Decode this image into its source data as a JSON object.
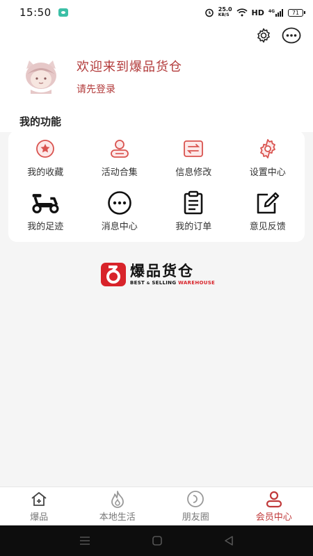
{
  "status_bar": {
    "time": "15:50",
    "net_speed_top": "25.0",
    "net_speed_unit": "KB/S",
    "network_label": "HD",
    "cell_label": "4G",
    "battery": "71"
  },
  "profile": {
    "welcome": "欢迎来到爆品货仓",
    "login_link": "请先登录"
  },
  "functions": {
    "title": "我的功能",
    "items": [
      {
        "label": "我的收藏",
        "icon": "star-badge-icon"
      },
      {
        "label": "活动合集",
        "icon": "user-card-icon"
      },
      {
        "label": "信息修改",
        "icon": "edit-info-icon"
      },
      {
        "label": "设置中心",
        "icon": "gear-icon"
      },
      {
        "label": "我的足迹",
        "icon": "scooter-icon"
      },
      {
        "label": "消息中心",
        "icon": "message-dots-icon"
      },
      {
        "label": "我的订单",
        "icon": "clipboard-icon"
      },
      {
        "label": "意见反馈",
        "icon": "pencil-square-icon"
      }
    ]
  },
  "brand": {
    "name_cn": "爆品货仓",
    "name_en_1": "BEST",
    "name_en_amp": "&",
    "name_en_2": "SELLING",
    "name_en_3": "WAREHOUSE"
  },
  "tabbar": {
    "tabs": [
      {
        "label": "爆品",
        "icon": "home-icon"
      },
      {
        "label": "本地生活",
        "icon": "flame-icon"
      },
      {
        "label": "朋友圈",
        "icon": "circle-friends-icon"
      },
      {
        "label": "会员中心",
        "icon": "member-icon",
        "active": true
      }
    ]
  },
  "colors": {
    "accent": "#c0393a",
    "brand_red": "#d8232a"
  }
}
